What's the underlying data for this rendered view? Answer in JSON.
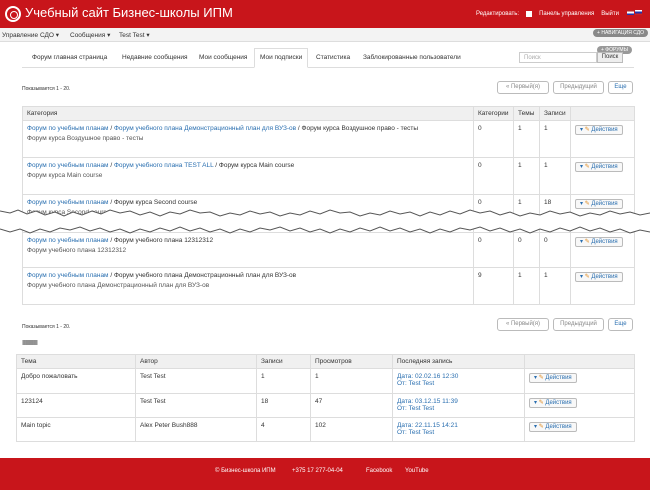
{
  "header": {
    "site_title": "Учебный сайт Бизнес-школы ИПМ",
    "edit_label": "Редактировать:",
    "control_panel": "Панель управления",
    "logout": "Выйти"
  },
  "menu": {
    "items": [
      "Управление СДО ▾",
      "Сообщения ▾",
      "Test Test ▾"
    ],
    "nav_pill": "+ НАВИГАЦИЯ СДО"
  },
  "forums_pill": "+ ФОРУМЫ",
  "tabs": [
    "Форум главная страница",
    "Недавние сообщения",
    "Мои сообщения",
    "Мои подписки",
    "Статистика",
    "Заблокированные пользователи"
  ],
  "search": {
    "placeholder": "Поиск",
    "button": "Поиск"
  },
  "pagination": {
    "showing": "Показывается 1 - 20.",
    "first": "« Первый(я)",
    "prev": "Предыдущий",
    "more": "Еще"
  },
  "categories_table": {
    "headers": [
      "Категория",
      "Категории",
      "Темы",
      "Записи",
      ""
    ],
    "rows": [
      {
        "path_a": "Форум по учебным планам",
        "path_b": "Форум учебного плана Демонстрационный план для ВУЗ-ов",
        "path_c": "Форум курса Воздушное право - тесты",
        "description": "Форум курса Воздушное право - тесты",
        "categories": "0",
        "threads": "1",
        "posts": "1",
        "action": "Действия"
      },
      {
        "path_a": "Форум по учебным планам",
        "path_b": "Форум учебного плана TEST ALL",
        "path_c": "Форум курса Main course",
        "description": "Форум курса Main course",
        "categories": "0",
        "threads": "1",
        "posts": "1",
        "action": "Действия"
      },
      {
        "path_a": "Форум по учебным планам",
        "path_b": "",
        "path_c": "Форум курса Second course",
        "description": "Форум курса Second course",
        "categories": "0",
        "threads": "1",
        "posts": "18",
        "action": "Действия"
      },
      {
        "path_a": "Форум по учебным планам",
        "path_b": "",
        "path_c": "Форум учебного плана 12312312",
        "description": "Форум учебного плана 12312312",
        "categories": "0",
        "threads": "0",
        "posts": "0",
        "action": "Действия"
      },
      {
        "path_a": "Форум по учебным планам",
        "path_b": "",
        "path_c": "Форум учебного плана Демонстрационный план для ВУЗ-ов",
        "description": "Форум учебного плана Демонстрационный план для ВУЗ-ов",
        "categories": "9",
        "threads": "1",
        "posts": "1",
        "action": "Действия"
      }
    ]
  },
  "bars_text": "||||||||||||||||||||||||||||||||||||||||||||||||||",
  "threads_table": {
    "headers": [
      "Тема",
      "Автор",
      "Записи",
      "Просмотров",
      "Последняя запись",
      ""
    ],
    "rows": [
      {
        "topic": "Добро пожаловать",
        "author": "Test Test",
        "posts": "1",
        "views": "1",
        "date": "Дата: 02.02.16 12:30",
        "from": "От: Test Test",
        "action": "Действия"
      },
      {
        "topic": "123124",
        "author": "Test Test",
        "posts": "18",
        "views": "47",
        "date": "Дата: 03.12.15 11:39",
        "from": "От: Test Test",
        "action": "Действия"
      },
      {
        "topic": "Main topic",
        "author": "Alex Peter Bush888",
        "posts": "4",
        "views": "102",
        "date": "Дата: 22.11.15 14:21",
        "from": "От: Test Test",
        "action": "Действия"
      }
    ]
  },
  "footer": {
    "copyright": "© Бизнес-школа ИПМ",
    "phone": "+375 17 277-04-04",
    "facebook": "Facebook",
    "youtube": "YouTube"
  },
  "colors": {
    "brand_red": "#c8151b",
    "link": "#2a6fb0"
  },
  "icons": [
    "logo-icon",
    "checkbox-icon",
    "flag-en-icon",
    "flag-ru-icon",
    "pencil-icon",
    "caret-down-icon"
  ]
}
